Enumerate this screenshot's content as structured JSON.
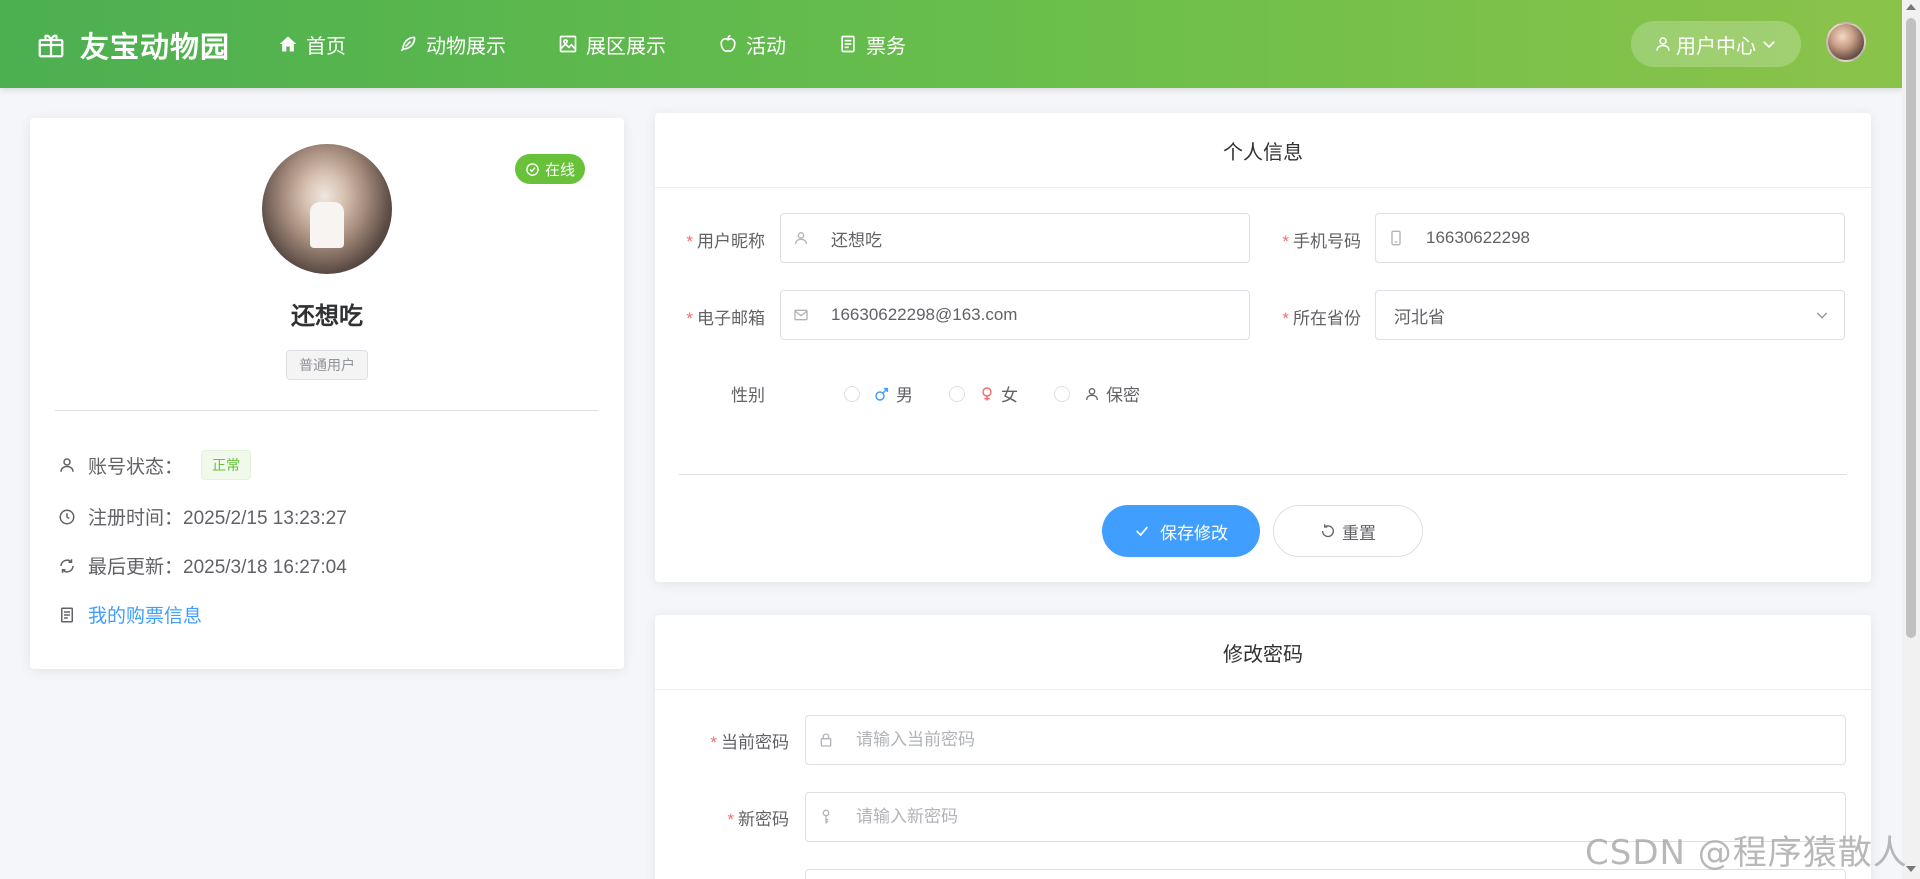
{
  "header": {
    "logo_text": "友宝动物园",
    "nav": [
      {
        "label": "首页",
        "icon": "home-icon"
      },
      {
        "label": "动物展示",
        "icon": "feather-icon"
      },
      {
        "label": "展区展示",
        "icon": "picture-icon"
      },
      {
        "label": "活动",
        "icon": "apple-icon"
      },
      {
        "label": "票务",
        "icon": "document-icon"
      }
    ],
    "user_center_label": "用户中心"
  },
  "profile": {
    "online_label": "在线",
    "name": "还想吃",
    "role": "普通用户",
    "status_label": "账号状态：",
    "status_value": "正常",
    "register_time": "注册时间：2025/2/15 13:23:27",
    "last_update": "最后更新：2025/3/18 16:27:04",
    "ticket_link": "我的购票信息"
  },
  "personal_info": {
    "title": "个人信息",
    "nickname_label": "用户昵称",
    "nickname_value": "还想吃",
    "phone_label": "手机号码",
    "phone_value": "16630622298",
    "email_label": "电子邮箱",
    "email_value": "16630622298@163.com",
    "province_label": "所在省份",
    "province_value": "河北省",
    "gender_label": "性别",
    "gender_options": [
      "男",
      "女",
      "保密"
    ],
    "save_button": "保存修改",
    "reset_button": "重置"
  },
  "password": {
    "title": "修改密码",
    "current_label": "当前密码",
    "current_placeholder": "请输入当前密码",
    "new_label": "新密码",
    "new_placeholder": "请输入新密码"
  },
  "watermark": "CSDN @程序猿散人",
  "colors": {
    "header_start": "#4caf50",
    "header_end": "#8bc34a",
    "primary": "#409eff",
    "success": "#67c23a",
    "required": "#f56c6c"
  }
}
